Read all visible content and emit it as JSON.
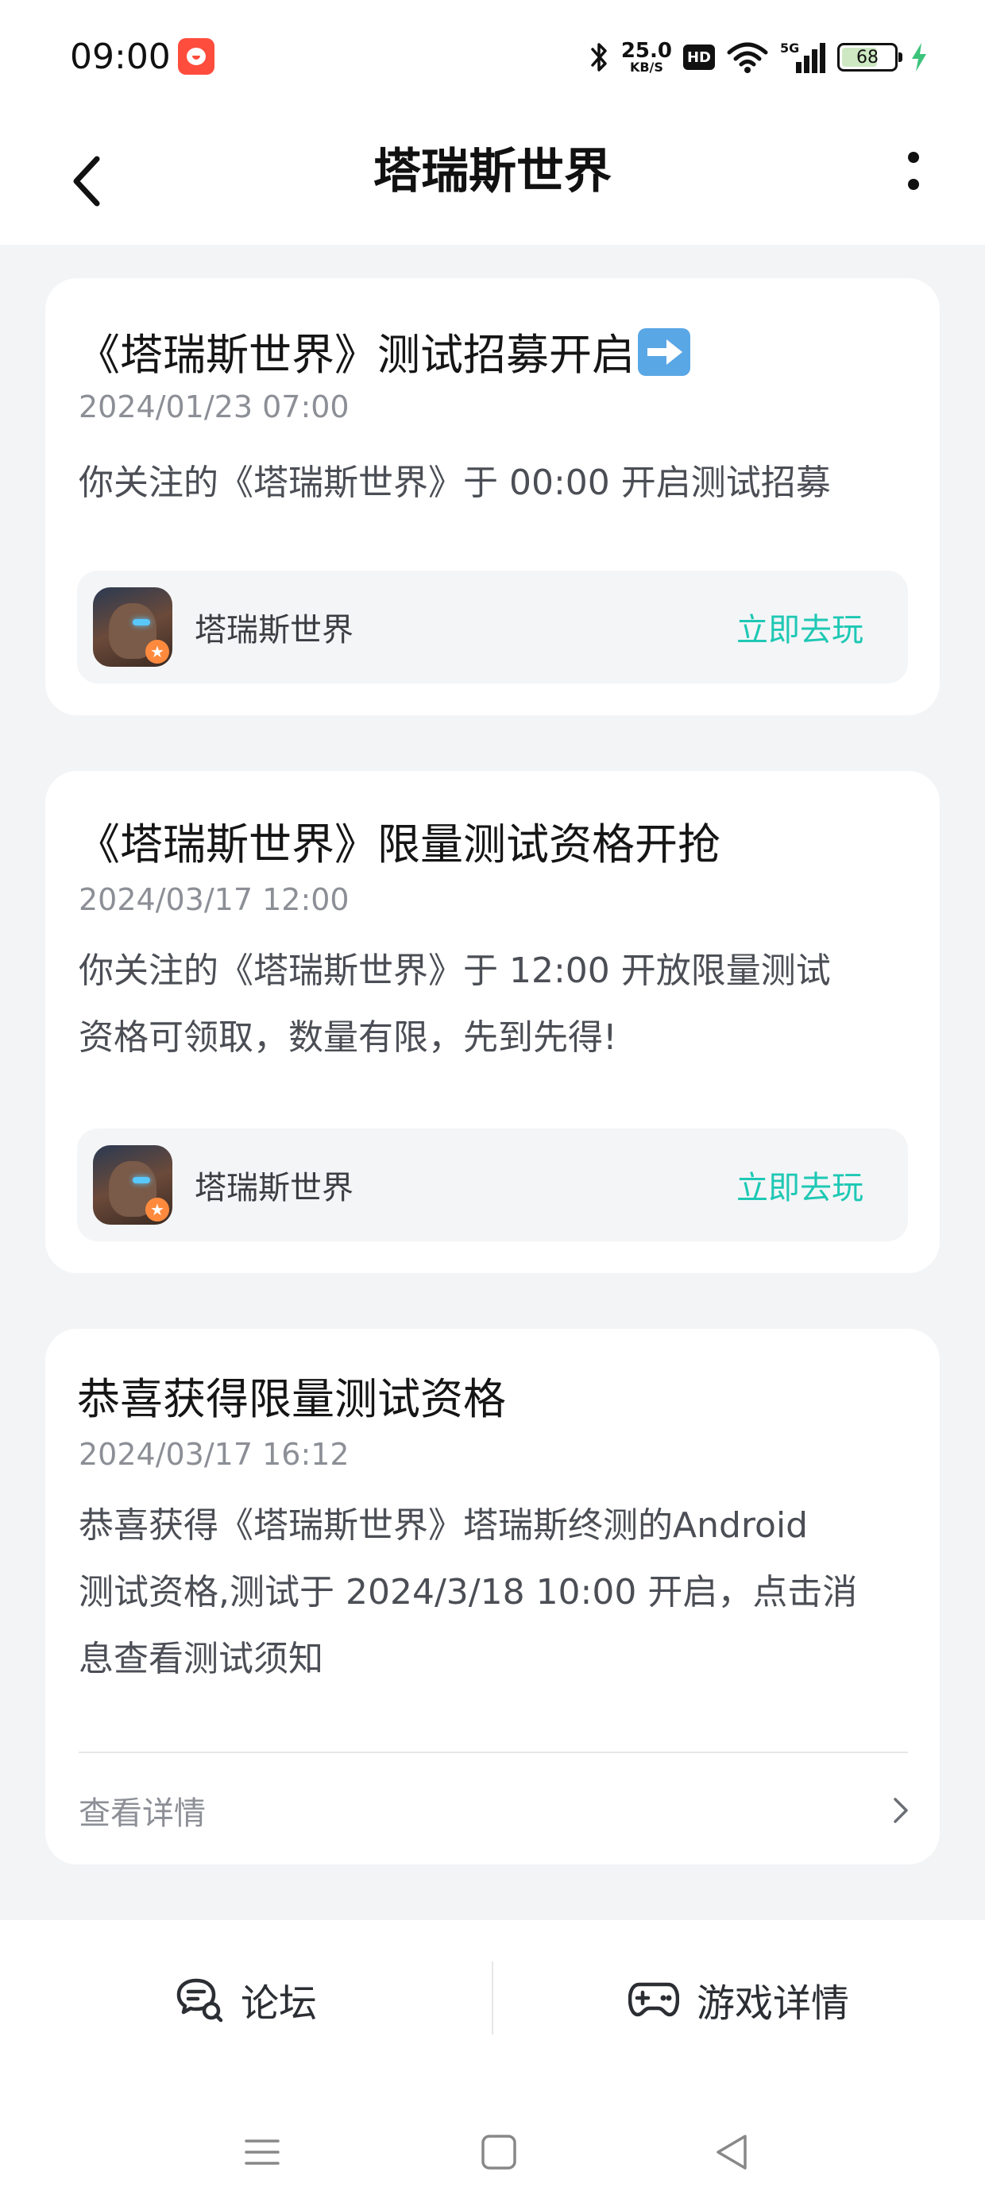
{
  "status_bar": {
    "time": "09:00",
    "net_speed_value": "25.0",
    "net_speed_unit": "KB/S",
    "hd_label": "HD",
    "signal_label": "5G",
    "battery": "68",
    "battery_level": 0.68
  },
  "header": {
    "title": "塔瑞斯世界"
  },
  "cards": [
    {
      "title": "《塔瑞斯世界》测试招募开启",
      "title_emoji": "right-arrow-emoji",
      "date": "2024/01/23 07:00",
      "body": "你关注的《塔瑞斯世界》于 00:00 开启测试招募",
      "game_name": "塔瑞斯世界",
      "action": "立即去玩"
    },
    {
      "title": "《塔瑞斯世界》限量测试资格开抢",
      "date": "2024/03/17 12:00",
      "body_line1": "你关注的《塔瑞斯世界》于 12:00 开放限量测试",
      "body_line2": "资格可领取，数量有限，先到先得!",
      "game_name": "塔瑞斯世界",
      "action": "立即去玩"
    },
    {
      "title": "恭喜获得限量测试资格",
      "date": "2024/03/17 16:12",
      "body_line1": "恭喜获得《塔瑞斯世界》塔瑞斯终测的Android",
      "body_line2": "测试资格,测试于 2024/3/18 10:00 开启，点击消",
      "body_line3": "息查看测试须知",
      "detail_label": "查看详情"
    }
  ],
  "bottom_tabs": {
    "forum": "论坛",
    "game_detail": "游戏详情"
  },
  "colors": {
    "accent": "#1ec8b4",
    "background": "#f3f4f6",
    "card": "#ffffff"
  }
}
